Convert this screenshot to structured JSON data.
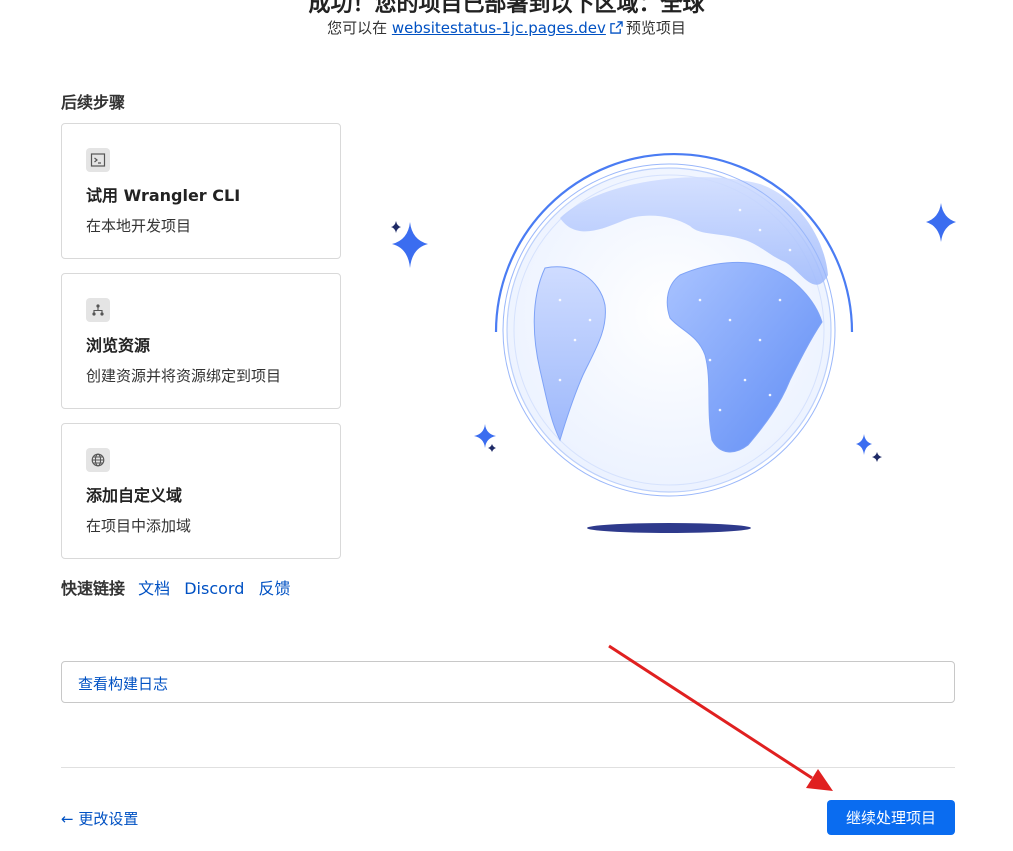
{
  "header": {
    "heading": "成功！您的项目已部署到以下区域：全球",
    "preview_prefix": "您可以在",
    "preview_url": "websitestatus-1jc.pages.dev",
    "preview_suffix": "预览项目",
    "external_link_icon": "external-link-icon"
  },
  "next_steps": {
    "title": "后续步骤",
    "cards": [
      {
        "icon": "terminal-icon",
        "title": "试用 Wrangler CLI",
        "description": "在本地开发项目"
      },
      {
        "icon": "resources-icon",
        "title": "浏览资源",
        "description": "创建资源并将资源绑定到项目"
      },
      {
        "icon": "globe-icon",
        "title": "添加自定义域",
        "description": "在项目中添加域"
      }
    ]
  },
  "quick_links": {
    "title": "快速链接",
    "links": [
      "文档",
      "Discord",
      "反馈"
    ]
  },
  "build_log": {
    "label": "查看构建日志"
  },
  "footer": {
    "back_label": "← 更改设置",
    "continue_label": "继续处理项目"
  },
  "colors": {
    "accent": "#0a6cf0",
    "link": "#0051c3",
    "annotation_arrow": "#e02020"
  }
}
